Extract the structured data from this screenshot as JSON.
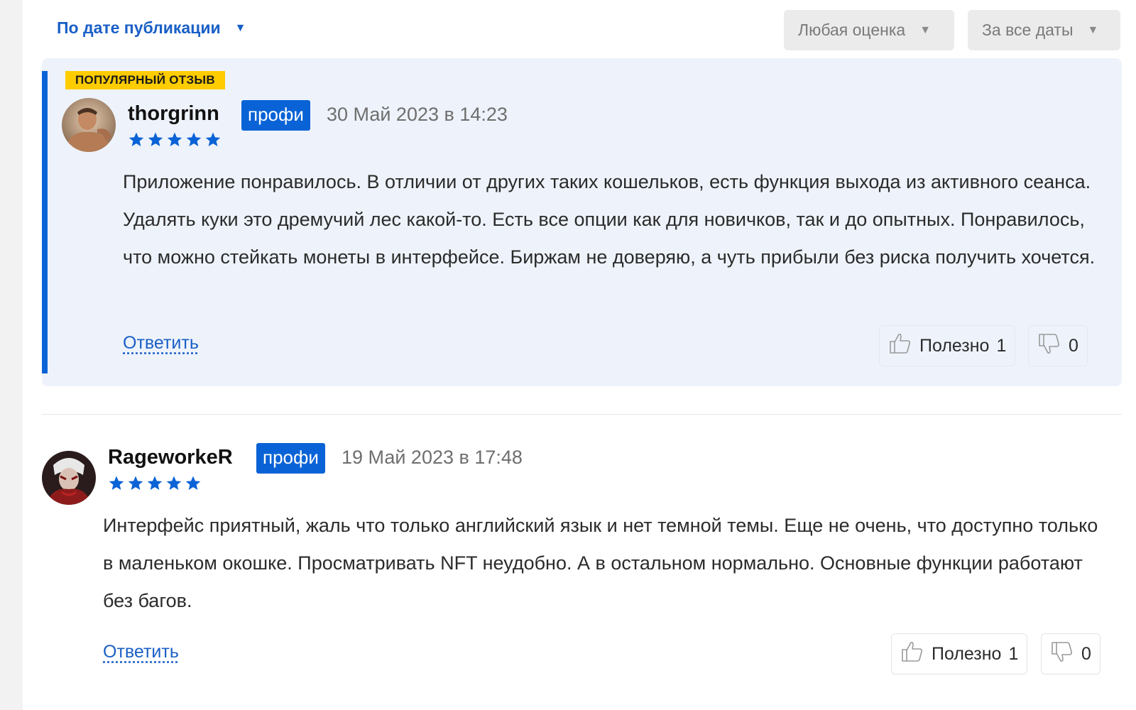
{
  "filters": {
    "sort_label": "По дате публикации",
    "rating_label": "Любая оценка",
    "dates_label": "За все даты"
  },
  "reviews": [
    {
      "popular_badge": "ПОПУЛЯРНЫЙ ОТЗЫВ",
      "username": "thorgrinn",
      "pro_label": "профи",
      "date": "30 Май 2023 в 14:23",
      "rating": 5,
      "rating_max": 5,
      "text": "Приложение понравилось. В отличии от других таких кошельков, есть функция выхода из активного сеанса. Удалять куки это дремучий лес какой-то. Есть все опции как для новичков, так и до опытных. Понравилось, что можно стейкать монеты в интерфейсе. Биржам не доверяю, а чуть прибыли без риска получить хочется.",
      "reply_label": "Ответить",
      "helpful_label": "Полезно",
      "helpful_count": "1",
      "unhelpful_count": "0"
    },
    {
      "username": "RageworkeR",
      "pro_label": "профи",
      "date": "19 Май 2023 в 17:48",
      "rating": 5,
      "rating_max": 5,
      "text": "Интерфейс приятный, жаль что только английский язык и нет темной темы. Еще не очень, что доступно только в маленьком окошке. Просматривать NFT неудобно. А в остальном нормально. Основные функции работают без багов.",
      "reply_label": "Ответить",
      "helpful_label": "Полезно",
      "helpful_count": "1",
      "unhelpful_count": "0"
    }
  ],
  "icons": {
    "sort_caret": "caret-down-icon",
    "filter_caret": "caret-down-icon",
    "star": "star-icon",
    "like": "thumbs-up-icon",
    "dislike": "thumbs-down-icon"
  },
  "colors": {
    "accent": "#0a63d6",
    "link": "#1a5fc6",
    "popular_badge": "#ffcc00",
    "popular_bg": "#eef3fb",
    "filter_bg": "#ebebeb",
    "star": "#0a63d6"
  }
}
